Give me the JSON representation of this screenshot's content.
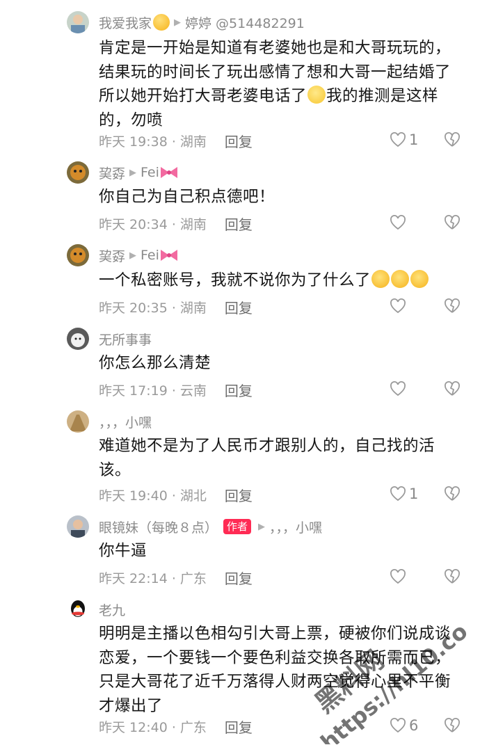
{
  "comments": [
    {
      "user": "我爱我家",
      "reply_to": "婷婷 @514482291",
      "text": "肯定是一开始是知道有老婆她也是和大哥玩玩的，结果玩的时间长了玩出感情了想和大哥一起结婚了所以她开始打大哥老婆电话了",
      "text_after_emoji": "我的推测是这样的，勿喷",
      "time": "昨天 19:38 · 湖南",
      "reply_label": "回复",
      "likes": "1"
    },
    {
      "user": "巭孬",
      "reply_to": "Fei",
      "text": "你自己为自己积点德吧！",
      "time": "昨天 20:34 · 湖南",
      "reply_label": "回复",
      "likes": ""
    },
    {
      "user": "巭孬",
      "reply_to": "Fei",
      "text": "一个私密账号，我就不说你为了什么了",
      "time": "昨天 20:35 · 湖南",
      "reply_label": "回复",
      "likes": ""
    },
    {
      "user": "无所事事",
      "reply_to": "",
      "text": "你怎么那么清楚",
      "time": "昨天 17:19 · 云南",
      "reply_label": "回复",
      "likes": ""
    },
    {
      "user": "，，，小嘿",
      "reply_to": "",
      "text": "难道她不是为了人民币才跟别人的，自己找的活该。",
      "time": "昨天 19:40 · 湖北",
      "reply_label": "回复",
      "likes": "1"
    },
    {
      "user": "眼镜妹（每晚８点）",
      "badge": "作者",
      "reply_to": "，，，小嘿",
      "text": "你牛逼",
      "time": "昨天 22:14 · 广东",
      "reply_label": "回复",
      "likes": ""
    },
    {
      "user": "老九",
      "reply_to": "",
      "text": "明明是主播以色相勾引大哥上票，硬被你们说成谈恋爱，一个要钱一个要色利益交换各取所需而已，只是大哥花了近千万落得人财两空觉得心里不平衡才爆出了",
      "time": "昨天 12:40 · 广东",
      "reply_label": "回复",
      "likes": "6"
    }
  ],
  "watermark": {
    "line1": "黑料网",
    "line2": "https://hl10.co"
  },
  "colors": {
    "accent": "#ff2b54",
    "meta_gray": "#9a9a9a",
    "text": "#161616"
  }
}
